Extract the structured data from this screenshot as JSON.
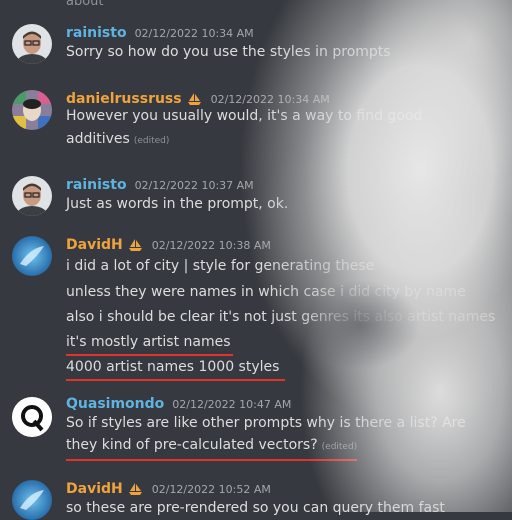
{
  "top_fragment": "about",
  "colors": {
    "background": "#36393f",
    "username_blue": "#5fb3e0",
    "username_orange": "#f0a23c",
    "underline_red": "#e0332e"
  },
  "messages": [
    {
      "username": "rainisto",
      "badge": null,
      "timestamp": "02/12/2022 10:34 AM",
      "lines": [
        {
          "text": "Sorry so how do you use the styles in prompts",
          "edited": null
        }
      ]
    },
    {
      "username": "danielrussruss",
      "badge": "boat-icon",
      "timestamp": "02/12/2022 10:34 AM",
      "lines": [
        {
          "text": "However you usually would, it's a way to find good",
          "edited": null
        },
        {
          "text": "additives",
          "edited": "(edited)"
        }
      ]
    },
    {
      "username": "rainisto",
      "badge": null,
      "timestamp": "02/12/2022 10:37 AM",
      "lines": [
        {
          "text": "Just as words in the prompt, ok.",
          "edited": null
        }
      ]
    },
    {
      "username": "DavidH",
      "badge": "boat-icon",
      "timestamp": "02/12/2022 10:38 AM",
      "lines": [
        {
          "text": "i did a lot of city | style for generating these",
          "edited": null
        },
        {
          "text": "unless they were names in which case i did city by name",
          "edited": null
        },
        {
          "text": "also i should be clear it's not just genres its also artist names",
          "edited": null
        },
        {
          "text": "it's mostly artist names",
          "edited": null
        },
        {
          "text": "4000 artist names 1000 styles",
          "edited": null
        }
      ]
    },
    {
      "username": "Quasimondo",
      "badge": null,
      "timestamp": "02/12/2022 10:47 AM",
      "lines": [
        {
          "text": "So if styles are like other prompts why is there a list? Are",
          "edited": null
        },
        {
          "text": "they kind of pre-calculated vectors?",
          "edited": "(edited)"
        }
      ]
    },
    {
      "username": "DavidH",
      "badge": "boat-icon",
      "timestamp": "02/12/2022 10:52 AM",
      "lines": [
        {
          "text": "so these are pre-rendered so you can query them fast",
          "edited": null
        }
      ]
    }
  ]
}
